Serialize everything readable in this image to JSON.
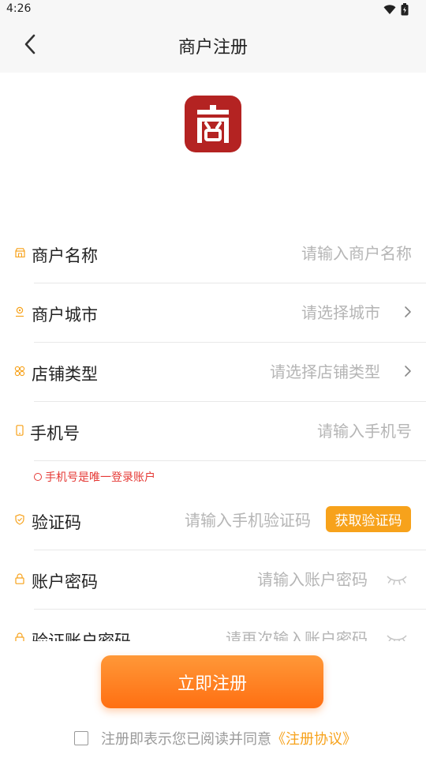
{
  "status_bar": {
    "time": "4:26"
  },
  "nav": {
    "title": "商户注册"
  },
  "form": {
    "merchant_name": {
      "label": "商户名称",
      "placeholder": "请输入商户名称",
      "value": ""
    },
    "merchant_city": {
      "label": "商户城市",
      "placeholder": "请选择城市"
    },
    "store_type": {
      "label": "店铺类型",
      "placeholder": "请选择店铺类型"
    },
    "phone": {
      "label": "手机号",
      "placeholder": "请输入手机号",
      "value": "",
      "hint": "手机号是唯一登录账户"
    },
    "verify_code": {
      "label": "验证码",
      "placeholder": "请输入手机验证码",
      "value": "",
      "button_label": "获取验证码"
    },
    "password": {
      "label": "账户密码",
      "placeholder": "请输入账户密码",
      "value": ""
    },
    "confirm_password": {
      "label": "验证账户密码",
      "placeholder": "请再次输入账户密码",
      "value": ""
    }
  },
  "submit": {
    "label": "立即注册"
  },
  "agreement": {
    "text": "注册即表示您已阅读并同意",
    "link": "《注册协议》",
    "checked": false
  },
  "colors": {
    "accent": "#f7a21b",
    "logo_red": "#b42322",
    "hint_red": "#e53935",
    "button_gradient": [
      "#ff9838",
      "#ff6f12"
    ]
  }
}
